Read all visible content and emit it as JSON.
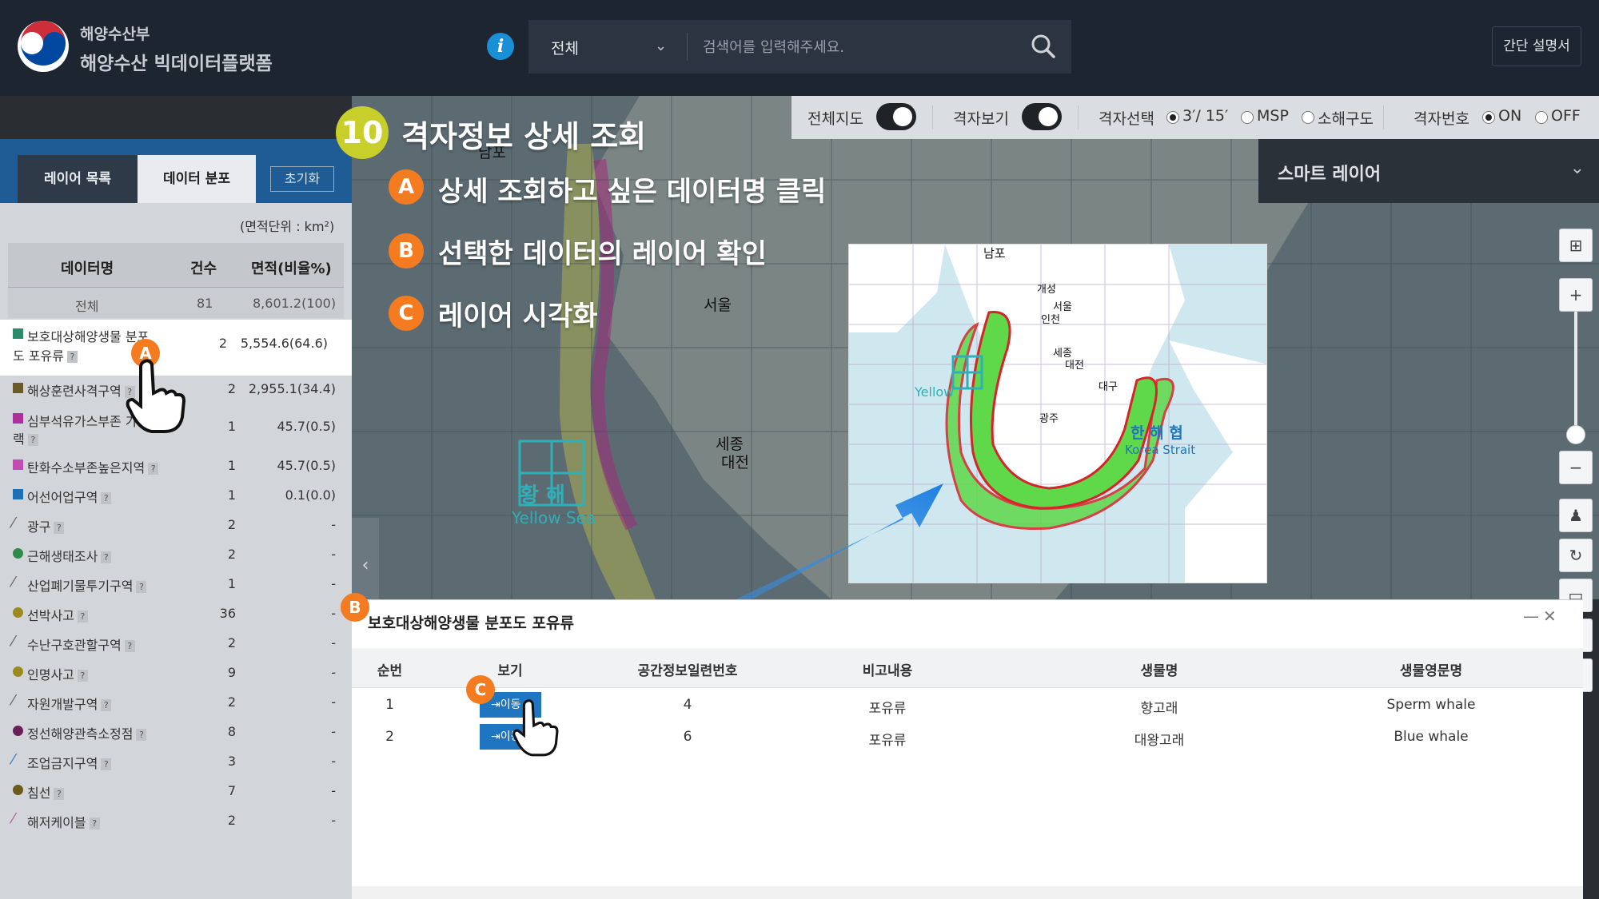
{
  "header": {
    "ministry": "해양수산부",
    "platform": "해양수산 빅데이터플랫폼",
    "info_label": "i",
    "search_scope": "전체",
    "search_placeholder": "검색어를 입력해주세요.",
    "guide_button": "간단 설명서"
  },
  "toggles": {
    "full_map": "전체지도",
    "grid_view": "격자보기",
    "grid_select": "격자선택",
    "grid_options": [
      "3′/ 15′",
      "MSP",
      "소해구도"
    ],
    "grid_number": "격자번호",
    "on": "ON",
    "off": "OFF"
  },
  "smart_layer": {
    "label": "스마트 레이어"
  },
  "left_panel": {
    "tabs": [
      "레이어 목록",
      "데이터 분포"
    ],
    "reset": "초기화",
    "unit": "(면적단위 : km²)",
    "columns": [
      "데이터명",
      "건수",
      "면적(비율%)"
    ],
    "total": {
      "name": "전체",
      "count": "81",
      "area": "8,601.2(100)"
    },
    "rows": [
      {
        "name1": "보호대상해양생물 분포",
        "name2": "도 포유류",
        "count": "2",
        "area": "5,554.6(64.6)",
        "color": "#2e8b6a"
      },
      {
        "name": "해상훈련사격구역",
        "count": "2",
        "area": "2,955.1(34.4)",
        "color": "#6b5a2a"
      },
      {
        "name1": "심부석유가스부존 가능",
        "name2": "랙",
        "count": "1",
        "area": "45.7(0.5)",
        "color": "#b0309a"
      },
      {
        "name": "탄화수소부존높은지역",
        "count": "1",
        "area": "45.7(0.5)",
        "color": "#c24bb0"
      },
      {
        "name": "어선어업구역",
        "count": "1",
        "area": "0.1(0.0)",
        "color": "#1f6fb5"
      },
      {
        "name": "광구",
        "count": "2",
        "area": "-",
        "line": "#555"
      },
      {
        "name": "근해생태조사",
        "count": "2",
        "area": "-",
        "dot": "#2e8b4a"
      },
      {
        "name": "산업폐기물투기구역",
        "count": "1",
        "area": "-",
        "line": "#555"
      },
      {
        "name": "선박사고",
        "count": "36",
        "area": "-",
        "dot": "#9a8a20"
      },
      {
        "name": "수난구호관할구역",
        "count": "2",
        "area": "-",
        "line": "#555"
      },
      {
        "name": "인명사고",
        "count": "9",
        "area": "-",
        "dot": "#9a8a20"
      },
      {
        "name": "자원개발구역",
        "count": "2",
        "area": "-",
        "line": "#555"
      },
      {
        "name": "정선해양관측소정점",
        "count": "8",
        "area": "-",
        "dot": "#6a1f5a"
      },
      {
        "name": "조업금지구역",
        "count": "3",
        "area": "-",
        "line": "#3a7bbf"
      },
      {
        "name": "침선",
        "count": "7",
        "area": "-",
        "dot": "#6b5a1a"
      },
      {
        "name": "해저케이블",
        "count": "2",
        "area": "-",
        "line": "#c05a9a"
      }
    ]
  },
  "detail_panel": {
    "title": "보호대상해양생물 분포도 포유류",
    "columns": [
      "순번",
      "보기",
      "공간정보일련번호",
      "비고내용",
      "생물명",
      "생물영문명"
    ],
    "rows": [
      {
        "no": "1",
        "view": "이동",
        "serial": "4",
        "note": "포유류",
        "species": "향고래",
        "english": "Sperm whale"
      },
      {
        "no": "2",
        "view": "이동",
        "serial": "6",
        "note": "포유류",
        "species": "대왕고래",
        "english": "Blue whale"
      }
    ]
  },
  "tutorial": {
    "step_number": "10",
    "step_title": "격자정보 상세 조회",
    "steps": [
      {
        "badge": "A",
        "text": "상세 조회하고 싶은 데이터명 클릭"
      },
      {
        "badge": "B",
        "text": "선택한 데이터의 레이어 확인"
      },
      {
        "badge": "C",
        "text": "레이어 시각화"
      }
    ]
  },
  "map_labels": {
    "main": [
      "남포",
      "개성",
      "서울",
      "인천",
      "세종",
      "대전",
      "황 해",
      "Yellow Sea"
    ],
    "inset": [
      "남포",
      "개성",
      "서울",
      "인천",
      "세종",
      "대전",
      "대구",
      "광주",
      "Yellow",
      "한 해 협",
      "Korea Strait"
    ]
  },
  "colors": {
    "header_bg": "#1d2530",
    "accent_blue": "#1f75c0",
    "badge_orange": "#f47b20",
    "step_yellow": "#c9cf2a",
    "protected_zone_green": "#5fd84a",
    "protected_zone_outline": "#d8232a"
  },
  "icons": [
    "korea-emblem-logo",
    "info-icon",
    "chevron-down-icon",
    "search-icon",
    "grid-icon",
    "plus-icon",
    "minus-icon",
    "pegman-icon",
    "rotate-icon",
    "ruler-icon",
    "fullscreen-icon",
    "globe-icon",
    "hand-pointer-icon",
    "close-icon",
    "minimize-icon"
  ]
}
